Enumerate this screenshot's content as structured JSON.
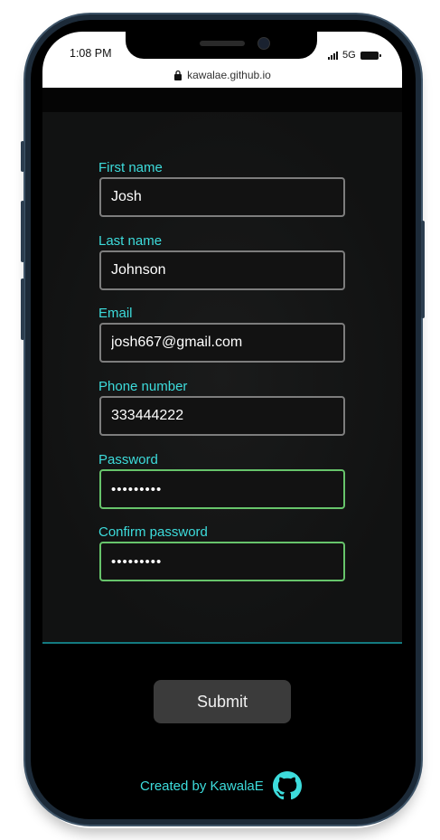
{
  "status_bar": {
    "time": "1:08 PM",
    "network": "5G"
  },
  "browser": {
    "url": "kawalae.github.io"
  },
  "form": {
    "first_name": {
      "label": "First name",
      "value": "Josh"
    },
    "last_name": {
      "label": "Last name",
      "value": "Johnson"
    },
    "email": {
      "label": "Email",
      "value": "josh667@gmail.com"
    },
    "phone": {
      "label": "Phone number",
      "value": "333444222"
    },
    "password": {
      "label": "Password",
      "value": "•••••••••"
    },
    "confirm_password": {
      "label": "Confirm password",
      "value": "•••••••••"
    },
    "submit_label": "Submit"
  },
  "footer": {
    "credit": "Created by KawalaE",
    "icon": "github-icon"
  },
  "colors": {
    "accent": "#3ddcdc",
    "input_border": "#7d7d7d",
    "valid_border": "#67c46b",
    "panel_background": "#121212",
    "button_background": "#3b3b3b"
  }
}
